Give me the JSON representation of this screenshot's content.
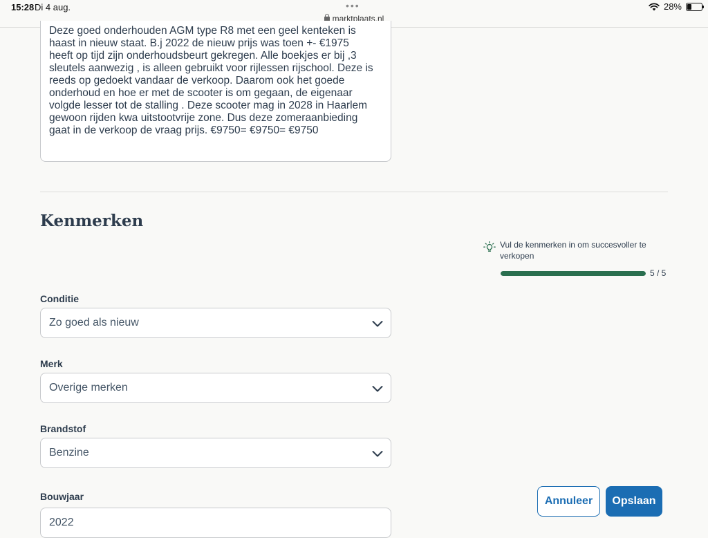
{
  "status_bar": {
    "time": "15:28",
    "date": "Di 4 aug.",
    "url": "marktplaats.nl",
    "battery": "28%",
    "battery_level": 0.28
  },
  "description": {
    "lines": [
      "Deze goed onderhouden AGM type R8 met een geel kenteken is",
      "haast in nieuw staat. B.j 2022 de nieuw prijs was toen +- €1975",
      "heeft op tijd zijn onderhoudsbeurt gekregen. Alle boekjes er bij ,3",
      "sleutels aanwezig , is alleen gebruikt voor rijlessen rijschool. Deze is",
      "reeds op gedoekt vandaar de verkoop. Daarom ook het goede",
      "onderhoud en hoe er met de scooter is om gegaan, de eigenaar",
      "volgde lesser tot de stalling . Deze scooter mag in 2028 in Haarlem",
      "gewoon rijden kwa uitstootvrije zone. Dus deze zomeraanbieding",
      "gaat in de verkoop de vraag prijs. €9750= €9750= €9750"
    ]
  },
  "kenmerken": {
    "title": "Kenmerken",
    "hint": "Vul de kenmerken in om succesvoller te verkopen",
    "progress_text": "5 / 5",
    "progress_fraction": 1.0,
    "fields": [
      {
        "label": "Conditie",
        "value": "Zo goed als nieuw"
      },
      {
        "label": "Merk",
        "value": "Overige merken"
      },
      {
        "label": "Brandstof",
        "value": "Benzine"
      },
      {
        "label": "Bouwjaar",
        "value": "2022"
      }
    ]
  },
  "actions": {
    "cancel_label": "Annuleer",
    "save_label": "Opslaan"
  },
  "colors": {
    "primary": "#1b6db3",
    "progress": "#2a6f4f",
    "text": "#2d3c4d"
  }
}
